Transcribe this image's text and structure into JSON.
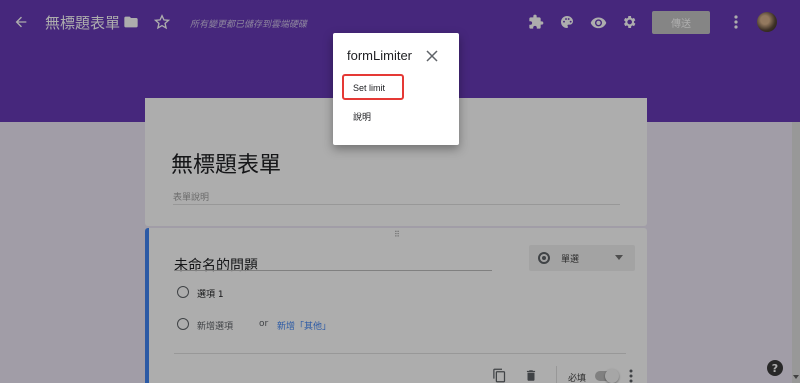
{
  "topbar": {
    "title": "無標題表單",
    "saved_status": "所有變更都已儲存到雲端硬碟",
    "send_label": "傳送",
    "icons": [
      "back-arrow-icon",
      "folder-icon",
      "star-icon",
      "puzzle-icon",
      "palette-icon",
      "eye-icon",
      "gear-icon",
      "more-vert-icon"
    ]
  },
  "form": {
    "title": "無標題表單",
    "description_placeholder": "表單說明"
  },
  "question": {
    "drag_handle": "⠿",
    "title_placeholder": "未命名的問題",
    "type_label": "單選",
    "option_1": "選項 1",
    "add_option": "新增選項",
    "or_label": "or",
    "add_other": "新增「其他」",
    "required_label": "必填",
    "icons": [
      "copy-icon",
      "trash-icon",
      "more-vert-icon"
    ]
  },
  "popup": {
    "title": "formLimiter",
    "items": [
      "Set limit",
      "說明"
    ],
    "highlighted_item": "Set limit"
  },
  "help": {
    "label": "?"
  },
  "colors": {
    "theme_purple": "#673ab7",
    "accent_blue": "#4285f4",
    "highlight_red": "#e53935",
    "background": "#ede7f6"
  }
}
